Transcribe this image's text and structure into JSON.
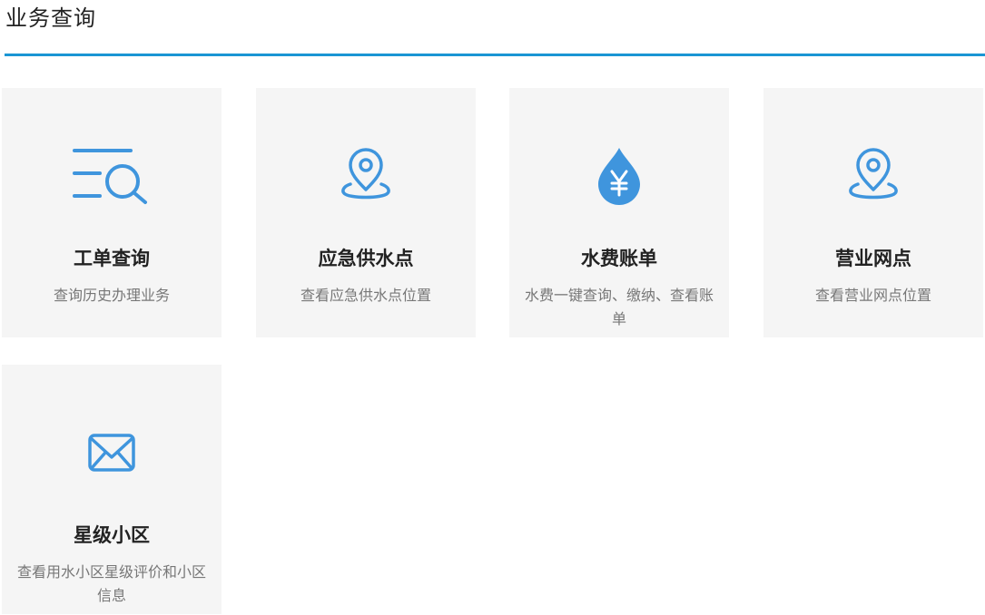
{
  "header": {
    "title": "业务查询"
  },
  "colors": {
    "accent": "#1a96d4",
    "icon": "#3f95dd",
    "card_bg": "#f5f5f5",
    "title_text": "#222222",
    "desc_text": "#777777"
  },
  "cards": [
    {
      "icon": "search-list-icon",
      "title": "工单查询",
      "desc": "查询历史办理业务"
    },
    {
      "icon": "location-pin-icon",
      "title": "应急供水点",
      "desc": "查看应急供水点位置"
    },
    {
      "icon": "water-drop-yen-icon",
      "title": "水费账单",
      "desc": "水费一键查询、缴纳、查看账单"
    },
    {
      "icon": "location-pin-icon",
      "title": "营业网点",
      "desc": "查看营业网点位置"
    },
    {
      "icon": "envelope-icon",
      "title": "星级小区",
      "desc": "查看用水小区星级评价和小区信息"
    }
  ]
}
